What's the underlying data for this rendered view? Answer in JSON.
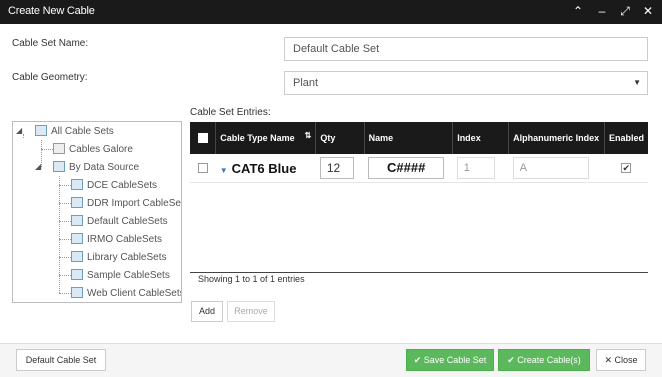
{
  "window": {
    "title": "Create New Cable",
    "controls": [
      "chevron-up-icon",
      "minimize-icon",
      "expand-icon",
      "close-icon"
    ]
  },
  "form": {
    "cable_set_name_label": "Cable Set Name:",
    "cable_set_name_value": "Default Cable Set",
    "cable_geometry_label": "Cable Geometry:",
    "cable_geometry_value": "Plant"
  },
  "tree": {
    "root": "All Cable Sets",
    "items": [
      "Cables Galore",
      "By Data Source",
      "DCE CableSets",
      "DDR Import CableSets",
      "Default CableSets",
      "IRMO CableSets",
      "Library CableSets",
      "Sample CableSets",
      "Web Client CableSets"
    ]
  },
  "entries": {
    "label": "Cable Set Entries:",
    "columns": [
      "Cable Type Name",
      "Qty",
      "Name",
      "Index",
      "Alphanumeric Index",
      "Enabled"
    ],
    "rows": [
      {
        "type_name": "CAT6 Blue",
        "qty": "12",
        "name": "C####",
        "index": "1",
        "alpha_index": "A",
        "enabled": true
      }
    ],
    "showing_text": "Showing 1 to 1 of 1 entries",
    "add_label": "Add",
    "remove_label": "Remove"
  },
  "footer": {
    "default_cable_set_label": "Default Cable Set",
    "save_cable_set_label": "Save Cable Set",
    "create_cables_label": "Create Cable(s)",
    "close_label": "Close"
  },
  "colors": {
    "titlebar": "#1a1a1a",
    "header": "#1a1a1a",
    "green": "#5cb85c"
  }
}
